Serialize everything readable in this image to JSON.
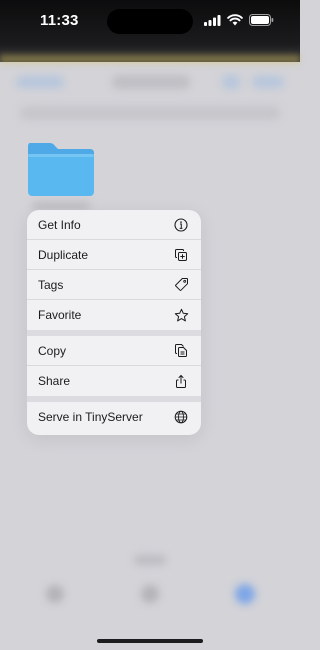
{
  "status_bar": {
    "time": "11:33"
  },
  "context_menu": {
    "groups": [
      [
        {
          "label": "Get Info",
          "icon": "info-circle-icon"
        },
        {
          "label": "Duplicate",
          "icon": "duplicate-icon"
        },
        {
          "label": "Tags",
          "icon": "tag-icon"
        },
        {
          "label": "Favorite",
          "icon": "star-icon"
        }
      ],
      [
        {
          "label": "Copy",
          "icon": "copy-icon"
        },
        {
          "label": "Share",
          "icon": "share-icon"
        }
      ],
      [
        {
          "label": "Serve in TinyServer",
          "icon": "globe-icon"
        }
      ]
    ]
  },
  "colors": {
    "folder": "#5ab8f0",
    "menu_background": "#f1f1f3",
    "backdrop": "#d3d3d8",
    "tab_accent": "#4a8fe8"
  }
}
